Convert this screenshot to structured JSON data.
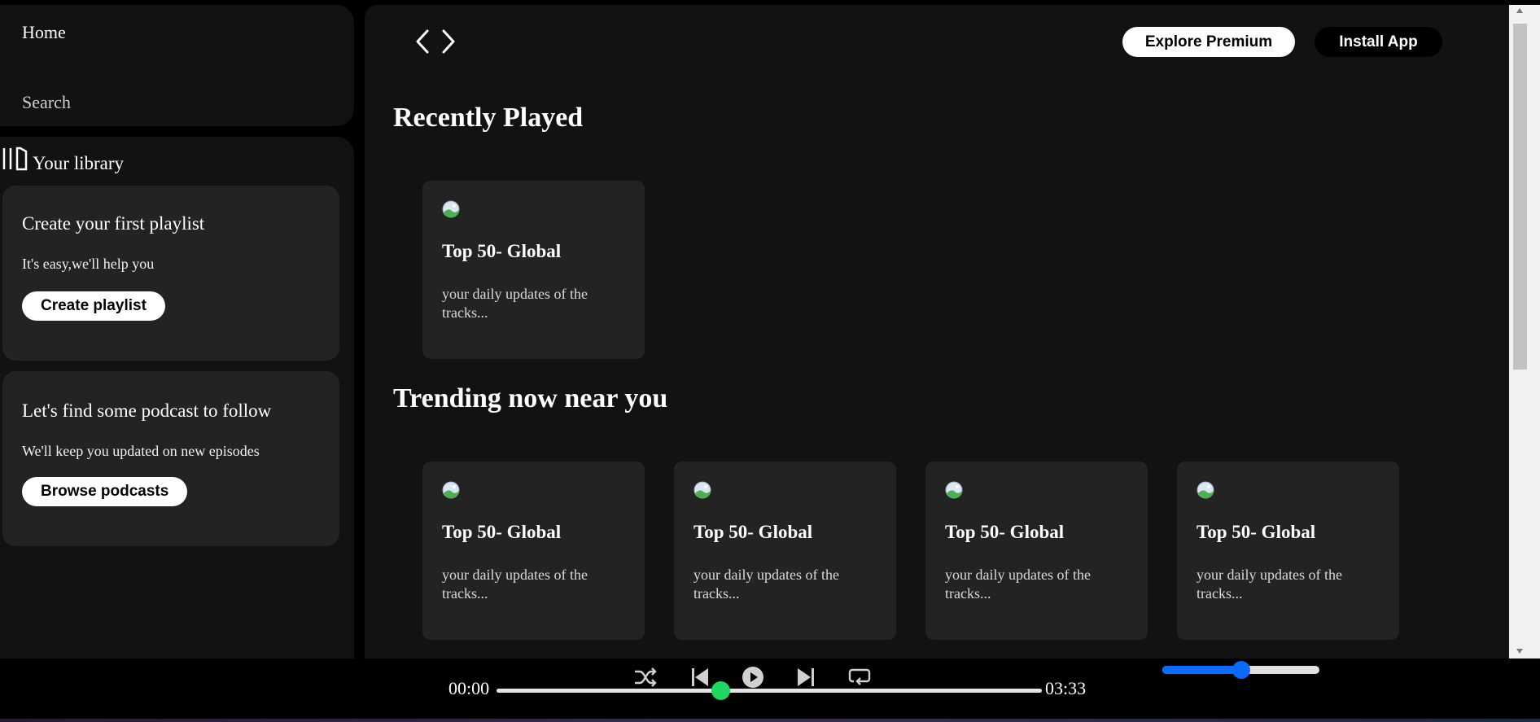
{
  "sidebar": {
    "nav": {
      "home_label": "Home",
      "search_label": "Search"
    },
    "library": {
      "title": "Your library",
      "cards": [
        {
          "heading": "Create your first playlist",
          "text": "It's easy,we'll help you",
          "button": "Create playlist"
        },
        {
          "heading": "Let's find some podcast to follow",
          "text": "We'll keep you updated on new episodes",
          "button": "Browse podcasts"
        }
      ]
    }
  },
  "header": {
    "back_icon": "chevron-left-icon",
    "forward_icon": "chevron-right-icon",
    "premium_label": "Explore Premium",
    "install_label": "Install App"
  },
  "sections": {
    "recent": {
      "title": "Recently Played",
      "cards": [
        {
          "title": "Top 50- Global",
          "desc": "your daily updates of the tracks..."
        }
      ]
    },
    "trending": {
      "title": "Trending now near you",
      "cards": [
        {
          "title": "Top 50- Global",
          "desc": "your daily updates of the tracks..."
        },
        {
          "title": "Top 50- Global",
          "desc": "your daily updates of the tracks..."
        },
        {
          "title": "Top 50- Global",
          "desc": "your daily updates of the tracks..."
        },
        {
          "title": "Top 50- Global",
          "desc": "your daily updates of the tracks..."
        }
      ]
    }
  },
  "player": {
    "icons": [
      "shuffle-icon",
      "previous-icon",
      "play-icon",
      "next-icon",
      "repeat-icon"
    ],
    "current_time": "00:00",
    "total_time": "03:33",
    "progress_fraction": 0.41,
    "volume_fraction": 0.5
  },
  "colors": {
    "accent": "#1ed760",
    "volume": "#0a6cff",
    "panel": "#121212",
    "card": "#232323"
  }
}
